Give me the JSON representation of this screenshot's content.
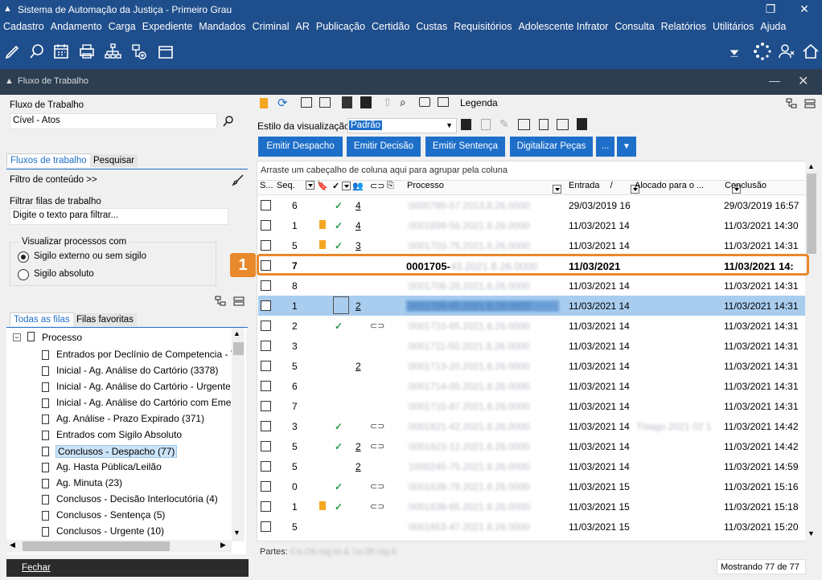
{
  "window": {
    "title": "Sistema de Automação da Justiça - Primeiro Grau",
    "controls": [
      "restore",
      "close"
    ]
  },
  "menu": [
    "Cadastro",
    "Andamento",
    "Carga",
    "Expediente",
    "Mandados",
    "Criminal",
    "AR",
    "Publicação",
    "Certidão",
    "Custas",
    "Requisitórios",
    "Adolescente Infrator",
    "Consulta",
    "Relatórios",
    "Utilitários",
    "Ajuda"
  ],
  "panel": {
    "title": "Fluxo de Trabalho"
  },
  "left": {
    "fluxo_label": "Fluxo de Trabalho",
    "fluxo_value": "Cível - Atos",
    "tabs": [
      "Fluxos de trabalho",
      "Pesquisar"
    ],
    "filtro_conteudo": "Filtro de conteúdo >>",
    "filtrar_label": "Filtrar filas de trabalho",
    "filtrar_placeholder": "Digite o texto para filtrar...",
    "visualizar_label": "Visualizar processos com",
    "radio1": "Sigilo externo ou sem sigilo",
    "radio2": "Sigilo absoluto",
    "tabs2": [
      "Todas as filas",
      "Filas favoritas"
    ],
    "tree_root": "Processo",
    "tree": [
      "Entrados por Declínio de Competencia - T",
      "Inicial - Ag. Análise do Cartório (3378)",
      "Inicial - Ag. Análise do Cartório - Urgente",
      "Inicial - Ag. Análise do Cartório com Emer",
      "Ag. Análise - Prazo Expirado (371)",
      "Entrados com Sigilo Absoluto",
      "Conclusos - Despacho (77)",
      "Ag. Hasta Pública/Leilão",
      "Ag. Minuta (23)",
      "Conclusos - Decisão Interlocutória (4)",
      "Conclusos - Sentença (5)",
      "Conclusos - Urgente (10)"
    ],
    "fechar": "Fechar"
  },
  "right": {
    "legenda": "Legenda",
    "estilo_label": "Estilo da visualização",
    "estilo_value": "Padrão",
    "buttons": [
      "Emitir Despacho",
      "Emitir Decisão",
      "Emitir Sentença",
      "Digitalizar Peças",
      "..."
    ],
    "group_hint": "Arraste um cabeçalho de coluna aqui para agrupar pela coluna",
    "columns": {
      "s": "S...",
      "seq": "Seq.",
      "processo": "Processo",
      "entrada": "Entrada",
      "alocado": "Alocado para o ...",
      "conclusao": "Conclusão"
    },
    "rows": [
      {
        "seq": "6",
        "flag": false,
        "check": true,
        "num": "4",
        "chain": false,
        "proc": "0000780-57.2013.8.26.0000",
        "entrada": "29/03/2019 16",
        "conclusao": "29/03/2019 16:57"
      },
      {
        "seq": "1",
        "flag": true,
        "check": true,
        "num": "4",
        "chain": false,
        "proc": "0001699-56.2021.8.26.0000",
        "entrada": "11/03/2021 14",
        "conclusao": "11/03/2021 14:30"
      },
      {
        "seq": "5",
        "flag": true,
        "check": true,
        "num": "3",
        "chain": false,
        "proc": "0001703-75.2021.8.26.0000",
        "entrada": "11/03/2021 14",
        "conclusao": "11/03/2021 14:31"
      },
      {
        "seq": "7",
        "flag": false,
        "check": false,
        "num": "",
        "chain": false,
        "proc": "0001705-",
        "entrada": "11/03/2021",
        "conclusao": "11/03/2021 14:",
        "highlight": true
      },
      {
        "seq": "8",
        "flag": false,
        "check": false,
        "num": "",
        "chain": false,
        "proc": "0001706-28.2021.8.26.0000",
        "entrada": "11/03/2021 14",
        "conclusao": "11/03/2021 14:31"
      },
      {
        "seq": "1",
        "flag": false,
        "check": false,
        "num": "2",
        "chain": false,
        "proc": "0001709-85.2021.8.26.0000",
        "entrada": "11/03/2021 14",
        "conclusao": "11/03/2021 14:31",
        "selected": true
      },
      {
        "seq": "2",
        "flag": false,
        "check": true,
        "num": "",
        "chain": true,
        "proc": "0001710-65.2021.8.26.0000",
        "entrada": "11/03/2021 14",
        "conclusao": "11/03/2021 14:31"
      },
      {
        "seq": "3",
        "flag": false,
        "check": false,
        "num": "",
        "chain": false,
        "proc": "0001711-50.2021.8.26.0000",
        "entrada": "11/03/2021 14",
        "conclusao": "11/03/2021 14:31"
      },
      {
        "seq": "5",
        "flag": false,
        "check": false,
        "num": "2",
        "chain": false,
        "proc": "0001713-20.2021.8.26.0000",
        "entrada": "11/03/2021 14",
        "conclusao": "11/03/2021 14:31"
      },
      {
        "seq": "6",
        "flag": false,
        "check": false,
        "num": "",
        "chain": false,
        "proc": "0001714-05.2021.8.26.0000",
        "entrada": "11/03/2021 14",
        "conclusao": "11/03/2021 14:31"
      },
      {
        "seq": "7",
        "flag": false,
        "check": false,
        "num": "",
        "chain": false,
        "proc": "0001715-87.2021.8.26.0000",
        "entrada": "11/03/2021 14",
        "conclusao": "11/03/2021 14:31"
      },
      {
        "seq": "3",
        "flag": false,
        "check": true,
        "num": "",
        "chain": true,
        "proc": "0001621-42.2021.8.26.0000",
        "entrada": "11/03/2021 14",
        "alocado": "Thiago 2021 02 1",
        "conclusao": "11/03/2021 14:42"
      },
      {
        "seq": "5",
        "flag": false,
        "check": true,
        "num": "2",
        "chain": true,
        "proc": "0001623-12.2021.8.26.0000",
        "entrada": "11/03/2021 14",
        "conclusao": "11/03/2021 14:42"
      },
      {
        "seq": "5",
        "flag": false,
        "check": false,
        "num": "2",
        "chain": false,
        "proc": "1000245-75.2021.8.26.0000",
        "entrada": "11/03/2021 14",
        "conclusao": "11/03/2021 14:59"
      },
      {
        "seq": "0",
        "flag": false,
        "check": true,
        "num": "",
        "chain": true,
        "proc": "0001638-79.2021.8.26.0000",
        "entrada": "11/03/2021 15",
        "conclusao": "11/03/2021 15:16"
      },
      {
        "seq": "1",
        "flag": true,
        "check": true,
        "num": "",
        "chain": true,
        "proc": "0001639-65.2021.8.26.0000",
        "entrada": "11/03/2021 15",
        "conclusao": "11/03/2021 15:18"
      },
      {
        "seq": "5",
        "flag": false,
        "check": false,
        "num": "",
        "chain": false,
        "proc": "0001653-47.2021.8.26.0000",
        "entrada": "11/03/2021 15",
        "conclusao": "11/03/2021 15:20"
      }
    ],
    "partes_label": "Partes:",
    "partes_value": "Ca.Ott.rag.bt & 1a.0ft.rag.b",
    "status": "Mostrando 77 de 77",
    "callout": "1"
  }
}
